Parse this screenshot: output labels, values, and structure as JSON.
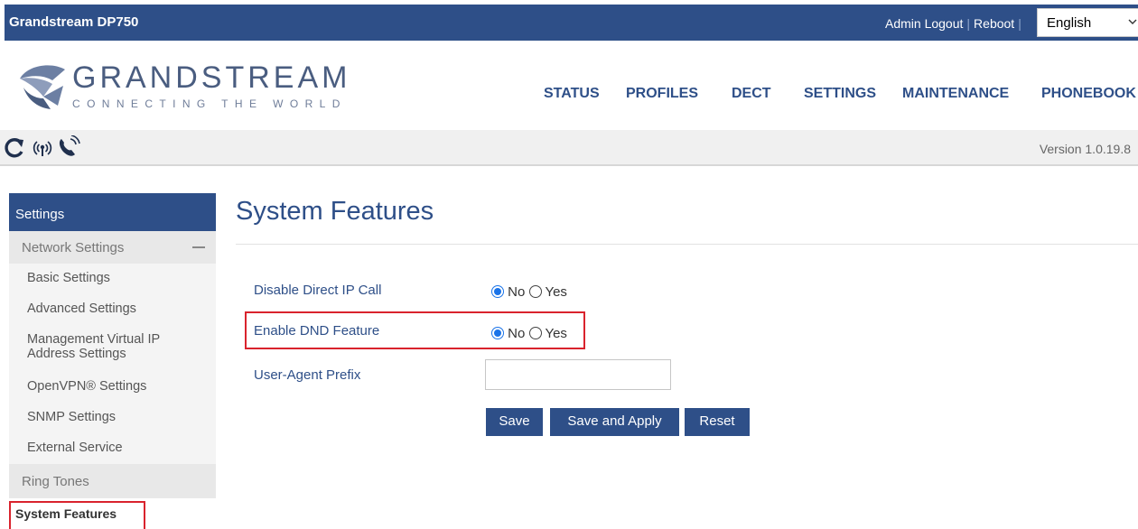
{
  "topbar": {
    "product": "Grandstream DP750",
    "admin_logout": "Admin Logout",
    "reboot": "Reboot",
    "language": "English"
  },
  "logo": {
    "brand": "GRANDSTREAM",
    "tagline": "CONNECTING THE WORLD"
  },
  "nav": [
    "STATUS",
    "PROFILES",
    "DECT",
    "SETTINGS",
    "MAINTENANCE",
    "PHONEBOOK"
  ],
  "toolbar": {
    "icons": [
      "refresh-icon",
      "wireless-signal-icon",
      "phone-call-icon"
    ],
    "version": "Version 1.0.19.8"
  },
  "sidebar": {
    "header": "Settings",
    "group_network": "Network Settings",
    "network_items": [
      "Basic Settings",
      "Advanced Settings",
      "Management Virtual IP Address Settings",
      "OpenVPN® Settings",
      "SNMP Settings",
      "External Service"
    ],
    "group_ringtones": "Ring Tones",
    "active_item": "System Features"
  },
  "main": {
    "title": "System Features",
    "fields": [
      {
        "label": "Disable Direct IP Call",
        "selected": "No",
        "options": [
          "No",
          "Yes"
        ]
      },
      {
        "label": "Enable DND Feature",
        "selected": "No",
        "options": [
          "No",
          "Yes"
        ]
      },
      {
        "label": "User-Agent Prefix",
        "value": ""
      }
    ],
    "buttons": {
      "save": "Save",
      "save_apply": "Save and Apply",
      "reset": "Reset"
    }
  },
  "colors": {
    "primary": "#2e4f88",
    "highlight": "#d9232d",
    "radio_selected": "#1a73e8"
  }
}
